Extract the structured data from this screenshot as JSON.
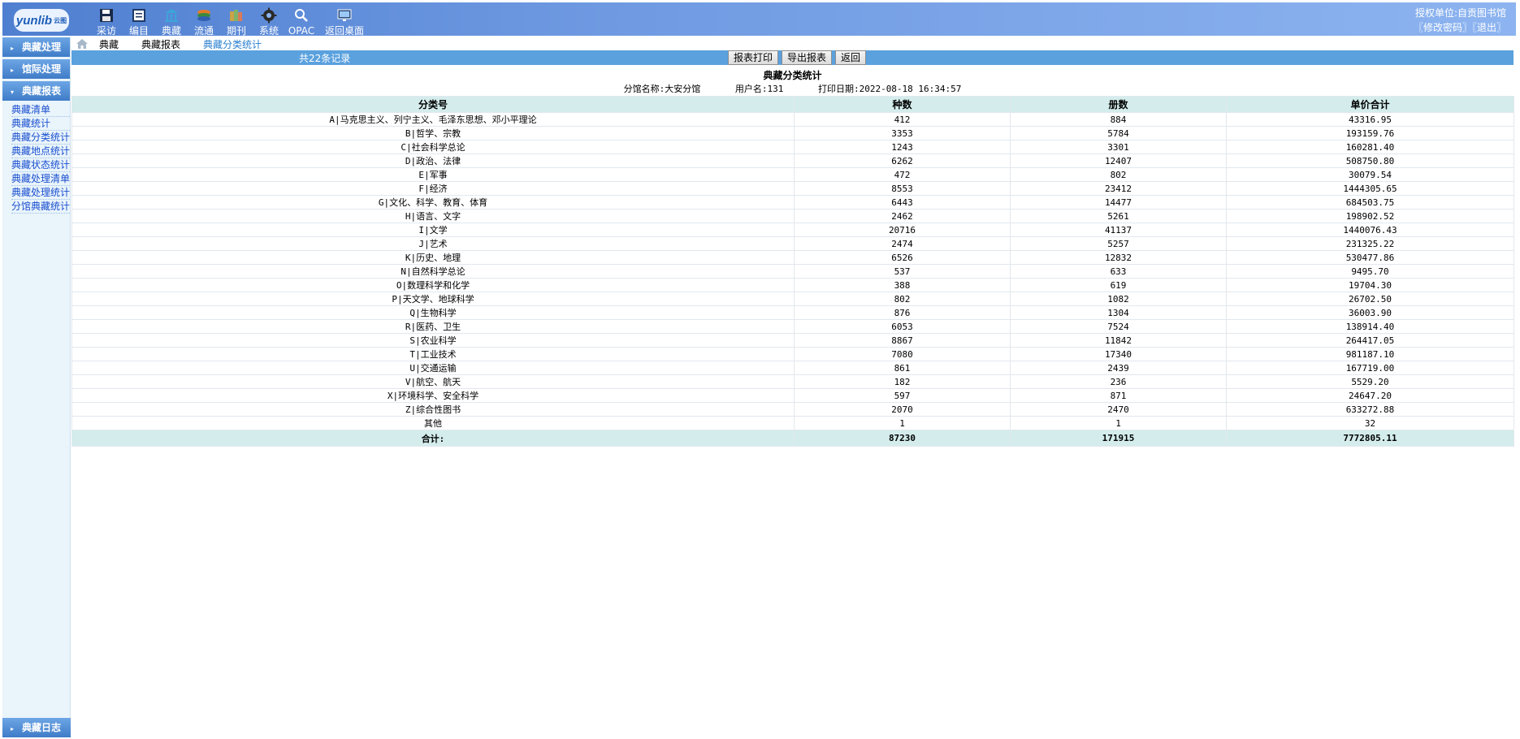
{
  "header": {
    "logo_text": "yunlib",
    "logo_sub": "云图",
    "nav": [
      {
        "label": "采访",
        "icon": "save-icon"
      },
      {
        "label": "编目",
        "icon": "catalog-icon"
      },
      {
        "label": "典藏",
        "icon": "library-icon"
      },
      {
        "label": "流通",
        "icon": "circulation-icon"
      },
      {
        "label": "期刊",
        "icon": "periodical-icon"
      },
      {
        "label": "系统",
        "icon": "gear-icon"
      },
      {
        "label": "OPAC",
        "icon": "search-icon"
      },
      {
        "label": "返回桌面",
        "icon": "desktop-icon"
      }
    ],
    "auth_unit": "授权单位:自贡图书馆",
    "change_password": "〖修改密码〗",
    "logout": "〖退出〗"
  },
  "sidebar": {
    "sections": [
      {
        "label": "典藏处理"
      },
      {
        "label": "馆际处理"
      },
      {
        "label": "典藏报表"
      }
    ],
    "links": [
      "典藏清单",
      "典藏统计",
      "典藏分类统计",
      "典藏地点统计",
      "典藏状态统计",
      "典藏处理清单",
      "典藏处理统计",
      "分馆典藏统计"
    ],
    "bottom": {
      "label": "典藏日志"
    }
  },
  "breadcrumb": {
    "items": [
      "典藏",
      "典藏报表",
      "典藏分类统计"
    ]
  },
  "toolbar": {
    "record_count": "共22条记录",
    "print_label": "报表打印",
    "export_label": "导出报表",
    "back_label": "返回"
  },
  "report": {
    "title": "典藏分类统计",
    "branch": "分馆名称:大安分馆",
    "user": "用户名:131",
    "print_date": "打印日期:2022-08-18 16:34:57",
    "columns": [
      "分类号",
      "种数",
      "册数",
      "单价合计"
    ],
    "rows": [
      [
        "A|马克思主义、列宁主义、毛泽东思想、邓小平理论",
        "412",
        "884",
        "43316.95"
      ],
      [
        "B|哲学、宗教",
        "3353",
        "5784",
        "193159.76"
      ],
      [
        "C|社会科学总论",
        "1243",
        "3301",
        "160281.40"
      ],
      [
        "D|政治、法律",
        "6262",
        "12407",
        "508750.80"
      ],
      [
        "E|军事",
        "472",
        "802",
        "30079.54"
      ],
      [
        "F|经济",
        "8553",
        "23412",
        "1444305.65"
      ],
      [
        "G|文化、科学、教育、体育",
        "6443",
        "14477",
        "684503.75"
      ],
      [
        "H|语言、文字",
        "2462",
        "5261",
        "198902.52"
      ],
      [
        "I|文学",
        "20716",
        "41137",
        "1440076.43"
      ],
      [
        "J|艺术",
        "2474",
        "5257",
        "231325.22"
      ],
      [
        "K|历史、地理",
        "6526",
        "12832",
        "530477.86"
      ],
      [
        "N|自然科学总论",
        "537",
        "633",
        "9495.70"
      ],
      [
        "O|数理科学和化学",
        "388",
        "619",
        "19704.30"
      ],
      [
        "P|天文学、地球科学",
        "802",
        "1082",
        "26702.50"
      ],
      [
        "Q|生物科学",
        "876",
        "1304",
        "36003.90"
      ],
      [
        "R|医药、卫生",
        "6053",
        "7524",
        "138914.40"
      ],
      [
        "S|农业科学",
        "8867",
        "11842",
        "264417.05"
      ],
      [
        "T|工业技术",
        "7080",
        "17340",
        "981187.10"
      ],
      [
        "U|交通运输",
        "861",
        "2439",
        "167719.00"
      ],
      [
        "V|航空、航天",
        "182",
        "236",
        "5529.20"
      ],
      [
        "X|环境科学、安全科学",
        "597",
        "871",
        "24647.20"
      ],
      [
        "Z|综合性图书",
        "2070",
        "2470",
        "633272.88"
      ],
      [
        "其他",
        "1",
        "1",
        "32"
      ]
    ],
    "total": [
      "合计:",
      "87230",
      "171915",
      "7772805.11"
    ]
  }
}
